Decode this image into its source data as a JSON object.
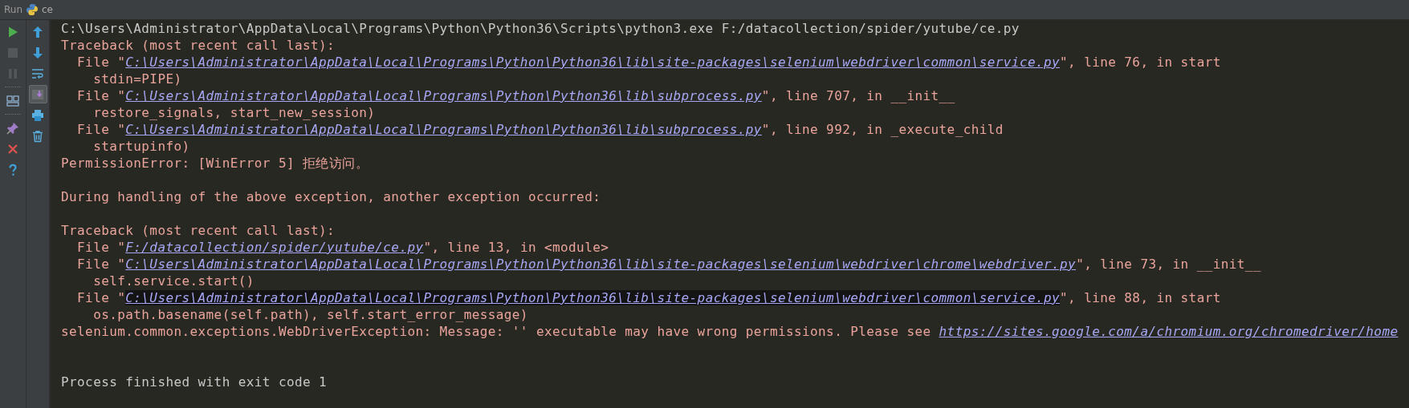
{
  "header": {
    "label": "Run",
    "tab": "ce"
  },
  "toolbar_main": [
    {
      "kind": "run",
      "disabled": false
    },
    {
      "kind": "stop",
      "disabled": true
    },
    {
      "kind": "pause",
      "disabled": true
    },
    {
      "kind": "separator"
    },
    {
      "kind": "layout",
      "disabled": false
    },
    {
      "kind": "separator"
    },
    {
      "kind": "pin",
      "disabled": false
    },
    {
      "kind": "close",
      "disabled": false
    },
    {
      "kind": "help",
      "disabled": false
    }
  ],
  "toolbar_side": [
    {
      "kind": "up",
      "selected": false
    },
    {
      "kind": "down",
      "selected": false
    },
    {
      "kind": "wrap",
      "selected": false
    },
    {
      "kind": "scroll-end",
      "selected": true
    },
    {
      "kind": "print",
      "selected": false
    },
    {
      "kind": "trash",
      "selected": false
    }
  ],
  "console": [
    {
      "kind": "system",
      "segments": [
        {
          "kind": "text",
          "text": "C:\\Users\\Administrator\\AppData\\Local\\Programs\\Python\\Python36\\Scripts\\python3.exe F:/datacollection/spider/yutube/ce.py"
        }
      ]
    },
    {
      "kind": "error",
      "segments": [
        {
          "kind": "text",
          "text": "Traceback (most recent call last):"
        }
      ]
    },
    {
      "kind": "error",
      "segments": [
        {
          "kind": "text",
          "text": "  File \""
        },
        {
          "kind": "link",
          "hovered": false,
          "text": "C:\\Users\\Administrator\\AppData\\Local\\Programs\\Python\\Python36\\lib\\site-packages\\selenium\\webdriver\\common\\service.py"
        },
        {
          "kind": "text",
          "text": "\", line 76, in start"
        }
      ]
    },
    {
      "kind": "error",
      "segments": [
        {
          "kind": "text",
          "text": "    stdin=PIPE)"
        }
      ]
    },
    {
      "kind": "error",
      "segments": [
        {
          "kind": "text",
          "text": "  File \""
        },
        {
          "kind": "link",
          "hovered": false,
          "text": "C:\\Users\\Administrator\\AppData\\Local\\Programs\\Python\\Python36\\lib\\subprocess.py"
        },
        {
          "kind": "text",
          "text": "\", line 707, in __init__"
        }
      ]
    },
    {
      "kind": "error",
      "segments": [
        {
          "kind": "text",
          "text": "    restore_signals, start_new_session)"
        }
      ]
    },
    {
      "kind": "error",
      "segments": [
        {
          "kind": "text",
          "text": "  File \""
        },
        {
          "kind": "link",
          "hovered": false,
          "text": "C:\\Users\\Administrator\\AppData\\Local\\Programs\\Python\\Python36\\lib\\subprocess.py"
        },
        {
          "kind": "text",
          "text": "\", line 992, in _execute_child"
        }
      ]
    },
    {
      "kind": "error",
      "segments": [
        {
          "kind": "text",
          "text": "    startupinfo)"
        }
      ]
    },
    {
      "kind": "error",
      "segments": [
        {
          "kind": "text",
          "text": "PermissionError: [WinError 5] 拒绝访问。"
        }
      ]
    },
    {
      "kind": "blank"
    },
    {
      "kind": "error",
      "segments": [
        {
          "kind": "text",
          "text": "During handling of the above exception, another exception occurred:"
        }
      ]
    },
    {
      "kind": "blank"
    },
    {
      "kind": "error",
      "segments": [
        {
          "kind": "text",
          "text": "Traceback (most recent call last):"
        }
      ]
    },
    {
      "kind": "error",
      "segments": [
        {
          "kind": "text",
          "text": "  File \""
        },
        {
          "kind": "link",
          "hovered": false,
          "text": "F:/datacollection/spider/yutube/ce.py"
        },
        {
          "kind": "text",
          "text": "\", line 13, in <module>"
        }
      ]
    },
    {
      "kind": "error",
      "segments": [
        {
          "kind": "text",
          "text": "  File \""
        },
        {
          "kind": "link",
          "hovered": false,
          "text": "C:\\Users\\Administrator\\AppData\\Local\\Programs\\Python\\Python36\\lib\\site-packages\\selenium\\webdriver\\chrome\\webdriver.py"
        },
        {
          "kind": "text",
          "text": "\", line 73, in __init__"
        }
      ]
    },
    {
      "kind": "error",
      "segments": [
        {
          "kind": "text",
          "text": "    self.service.start()"
        }
      ]
    },
    {
      "kind": "error",
      "segments": [
        {
          "kind": "text",
          "text": "  File \""
        },
        {
          "kind": "link",
          "hovered": true,
          "text": "C:\\Users\\Administrator\\AppData\\Local\\Programs\\Python\\Python36\\lib\\site-packages\\selenium\\webdriver\\common\\service.py"
        },
        {
          "kind": "text",
          "text": "\", line 88, in start"
        }
      ]
    },
    {
      "kind": "error",
      "segments": [
        {
          "kind": "text",
          "text": "    os.path.basename(self.path), self.start_error_message)"
        }
      ]
    },
    {
      "kind": "error",
      "segments": [
        {
          "kind": "text",
          "text": "selenium.common.exceptions.WebDriverException: Message: '' executable may have wrong permissions. Please see "
        },
        {
          "kind": "link",
          "hovered": false,
          "text": "https://sites.google.com/a/chromium.org/chromedriver/home"
        }
      ]
    },
    {
      "kind": "blank"
    },
    {
      "kind": "blank"
    },
    {
      "kind": "system",
      "segments": [
        {
          "kind": "text",
          "text": "Process finished with exit code 1"
        }
      ]
    }
  ]
}
